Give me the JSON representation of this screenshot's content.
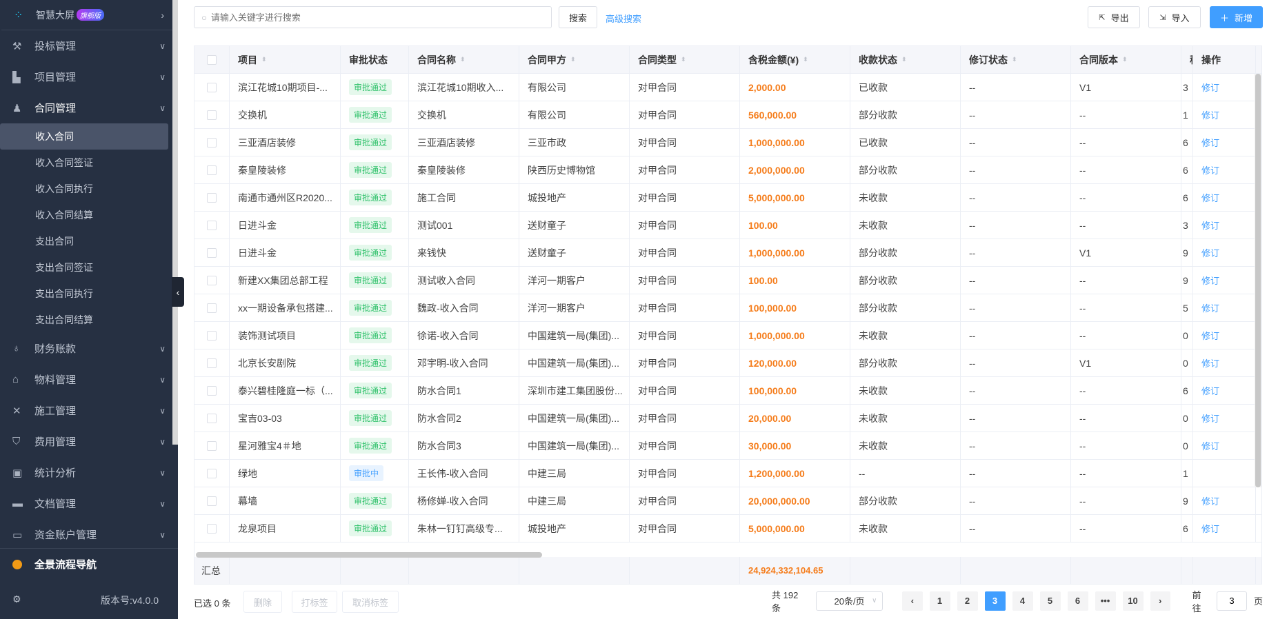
{
  "sidebar": {
    "top": {
      "label": "智慧大屏",
      "badge": "旗舰版"
    },
    "menus": [
      {
        "label": "投标管理",
        "icon": "gavel-icon",
        "glyph": "⚒"
      },
      {
        "label": "项目管理",
        "icon": "building-icon",
        "glyph": "▙"
      },
      {
        "label": "合同管理",
        "icon": "stamp-icon",
        "glyph": "♟",
        "open": true,
        "children": [
          "收入合同",
          "收入合同签证",
          "收入合同执行",
          "收入合同结算",
          "支出合同",
          "支出合同签证",
          "支出合同执行",
          "支出合同结算"
        ]
      },
      {
        "label": "财务账款",
        "icon": "money-bag-icon",
        "glyph": "♁"
      },
      {
        "label": "物料管理",
        "icon": "warehouse-icon",
        "glyph": "⌂"
      },
      {
        "label": "施工管理",
        "icon": "tools-icon",
        "glyph": "✕"
      },
      {
        "label": "费用管理",
        "icon": "shield-icon",
        "glyph": "⛉"
      },
      {
        "label": "统计分析",
        "icon": "chart-icon",
        "glyph": "▣"
      },
      {
        "label": "文档管理",
        "icon": "folder-icon",
        "glyph": "▬"
      },
      {
        "label": "资金账户管理",
        "icon": "card-icon",
        "glyph": "▭"
      }
    ],
    "flow": "全景流程导航",
    "version": "版本号:v4.0.0"
  },
  "toolbar": {
    "search_placeholder": "请输入关键字进行搜索",
    "search": "搜索",
    "advanced": "高级搜索",
    "export": "导出",
    "import": "导入",
    "add": "新增"
  },
  "table": {
    "columns": [
      "项目",
      "审批状态",
      "合同名称",
      "合同甲方",
      "合同类型",
      "含税金额(¥)",
      "收款状态",
      "修订状态",
      "合同版本",
      "税",
      "操作"
    ],
    "rows": [
      [
        "滨江花城10期项目-...",
        "审批通过",
        "滨江花城10期收入...",
        "有限公司",
        "对甲合同",
        "2,000.00",
        "已收款",
        "--",
        "V1",
        "3",
        "修订"
      ],
      [
        "交换机",
        "审批通过",
        "交换机",
        "有限公司",
        "对甲合同",
        "560,000.00",
        "部分收款",
        "--",
        "--",
        "1",
        "修订"
      ],
      [
        "三亚酒店装修",
        "审批通过",
        "三亚酒店装修",
        "三亚市政",
        "对甲合同",
        "1,000,000.00",
        "已收款",
        "--",
        "--",
        "6",
        "修订"
      ],
      [
        "秦皇陵装修",
        "审批通过",
        "秦皇陵装修",
        "陕西历史博物馆",
        "对甲合同",
        "2,000,000.00",
        "部分收款",
        "--",
        "--",
        "6",
        "修订"
      ],
      [
        "南通市通州区R2020...",
        "审批通过",
        "施工合同",
        "城投地产",
        "对甲合同",
        "5,000,000.00",
        "未收款",
        "--",
        "--",
        "6",
        "修订"
      ],
      [
        "日进斗金",
        "审批通过",
        "测试001",
        "送财童子",
        "对甲合同",
        "100.00",
        "未收款",
        "--",
        "--",
        "3",
        "修订"
      ],
      [
        "日进斗金",
        "审批通过",
        "来钱快",
        "送财童子",
        "对甲合同",
        "1,000,000.00",
        "部分收款",
        "--",
        "V1",
        "9",
        "修订"
      ],
      [
        "新建XX集团总部工程",
        "审批通过",
        "测试收入合同",
        "洋河一期客户",
        "对甲合同",
        "100.00",
        "部分收款",
        "--",
        "--",
        "9",
        "修订"
      ],
      [
        "xx一期设备承包搭建...",
        "审批通过",
        "魏政-收入合同",
        "洋河一期客户",
        "对甲合同",
        "100,000.00",
        "部分收款",
        "--",
        "--",
        "5",
        "修订"
      ],
      [
        "装饰测试项目",
        "审批通过",
        "徐诺-收入合同",
        "中国建筑一局(集团)...",
        "对甲合同",
        "1,000,000.00",
        "未收款",
        "--",
        "--",
        "0",
        "修订"
      ],
      [
        "北京长安剧院",
        "审批通过",
        "邓宇明-收入合同",
        "中国建筑一局(集团)...",
        "对甲合同",
        "120,000.00",
        "部分收款",
        "--",
        "V1",
        "0",
        "修订"
      ],
      [
        "泰兴碧桂隆庭一标（...",
        "审批通过",
        "防水合同1",
        "深圳市建工集团股份...",
        "对甲合同",
        "100,000.00",
        "未收款",
        "--",
        "--",
        "6",
        "修订"
      ],
      [
        "宝吉03-03",
        "审批通过",
        "防水合同2",
        "中国建筑一局(集团)...",
        "对甲合同",
        "20,000.00",
        "未收款",
        "--",
        "--",
        "0",
        "修订"
      ],
      [
        "星河雅宝4＃地",
        "审批通过",
        "防水合同3",
        "中国建筑一局(集团)...",
        "对甲合同",
        "30,000.00",
        "未收款",
        "--",
        "--",
        "0",
        "修订"
      ],
      [
        "绿地",
        "审批中",
        "王长伟-收入合同",
        "中建三局",
        "对甲合同",
        "1,200,000.00",
        "--",
        "--",
        "--",
        "1",
        ""
      ],
      [
        "幕墙",
        "审批通过",
        "杨修婵-收入合同",
        "中建三局",
        "对甲合同",
        "20,000,000.00",
        "部分收款",
        "--",
        "--",
        "9",
        "修订"
      ],
      [
        "龙泉项目",
        "审批通过",
        "朱林一钉钉高级专...",
        "城投地产",
        "对甲合同",
        "5,000,000.00",
        "未收款",
        "--",
        "--",
        "6",
        "修订"
      ]
    ],
    "summary_label": "汇总",
    "summary_total": "24,924,332,104.65"
  },
  "footer": {
    "selected": "已选 0 条",
    "delete": "删除",
    "tag": "打标签",
    "untag": "取消标签",
    "total": "共 192 条",
    "page_size": "20条/页",
    "pages": [
      "1",
      "2",
      "3",
      "4",
      "5",
      "6",
      "•••",
      "10"
    ],
    "current": "3",
    "goto_label": "前往",
    "goto_value": "3",
    "page_unit": "页"
  },
  "colors": {
    "accent": "#409eff",
    "amount": "#f57c1a",
    "approved": "#2fc16a",
    "sidebar": "#263042"
  }
}
